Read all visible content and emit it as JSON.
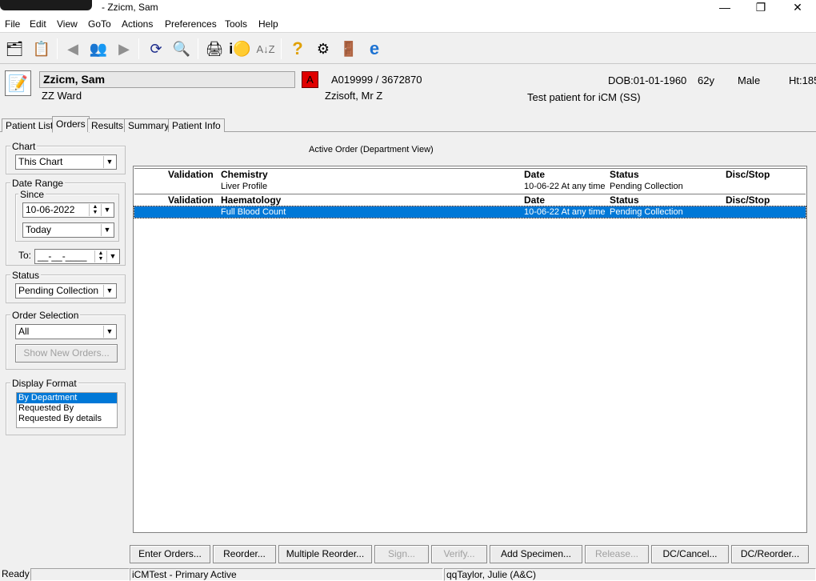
{
  "window": {
    "title": "- Zzicm, Sam",
    "minimize_glyph": "—",
    "restore_glyph": "❐",
    "close_glyph": "✕"
  },
  "menu": [
    "File",
    "Edit",
    "View",
    "GoTo",
    "Actions",
    "Preferences",
    "Tools",
    "Help"
  ],
  "toolbar": {
    "icons": [
      "patient-list-icon",
      "chart-icon",
      "back-arrow-icon",
      "patients-group-icon",
      "forward-arrow-icon",
      "refresh-icon",
      "search-tools-icon",
      "printer-icon",
      "info-icon",
      "sort-az-icon",
      "help-icon",
      "settings-icon",
      "exit-icon",
      "internet-explorer-icon"
    ]
  },
  "patient": {
    "name": "Zzicm, Sam",
    "alert": "A",
    "ids": "A019999 / 3672870",
    "dob": "DOB:01-01-1960",
    "age": "62y",
    "sex": "Male",
    "height": "Ht:185",
    "ward": "ZZ Ward",
    "consultant": "Zzisoft, Mr Z",
    "note": "Test patient for iCM (SS)"
  },
  "tabs": [
    "Patient List",
    "Orders",
    "Results",
    "Summary",
    "Patient Info"
  ],
  "active_tab": "Orders",
  "filters": {
    "chart_label": "Chart",
    "chart_value": "This Chart",
    "date_range_label": "Date Range",
    "since_label": "Since",
    "since_date": "10-06-2022",
    "since_preset": "Today",
    "to_label": "To:",
    "to_date": "__-__-____",
    "status_label": "Status",
    "status_value": "Pending Collection",
    "order_selection_label": "Order Selection",
    "order_selection_value": "All",
    "show_new_orders": "Show New Orders...",
    "display_format_label": "Display Format",
    "display_format_options": [
      "By Department",
      "Requested By",
      "Requested By details"
    ],
    "display_format_selected": "By Department"
  },
  "orders": {
    "view_title": "Active Order (Department View)",
    "columns": [
      "Validation",
      "Date",
      "Status",
      "Disc/Stop"
    ],
    "groups": [
      {
        "department": "Chemistry",
        "rows": [
          {
            "order": "Liver Profile",
            "date": "10-06-22 At any time",
            "status": "Pending Collection",
            "disc": "",
            "selected": false
          }
        ]
      },
      {
        "department": "Haematology",
        "rows": [
          {
            "order": "Full Blood Count",
            "date": "10-06-22 At any time",
            "status": "Pending Collection",
            "disc": "",
            "selected": true
          }
        ]
      }
    ]
  },
  "buttons": {
    "enter_orders": "Enter Orders...",
    "reorder": "Reorder...",
    "multiple_reorder": "Multiple Reorder...",
    "sign": "Sign...",
    "verify": "Verify...",
    "add_specimen": "Add Specimen...",
    "release": "Release...",
    "dc_cancel": "DC/Cancel...",
    "dc_reorder": "DC/Reorder..."
  },
  "status_bar": {
    "state": "Ready",
    "environment": "iCMTest - Primary Active",
    "user": "qqTaylor, Julie  (A&C)"
  }
}
